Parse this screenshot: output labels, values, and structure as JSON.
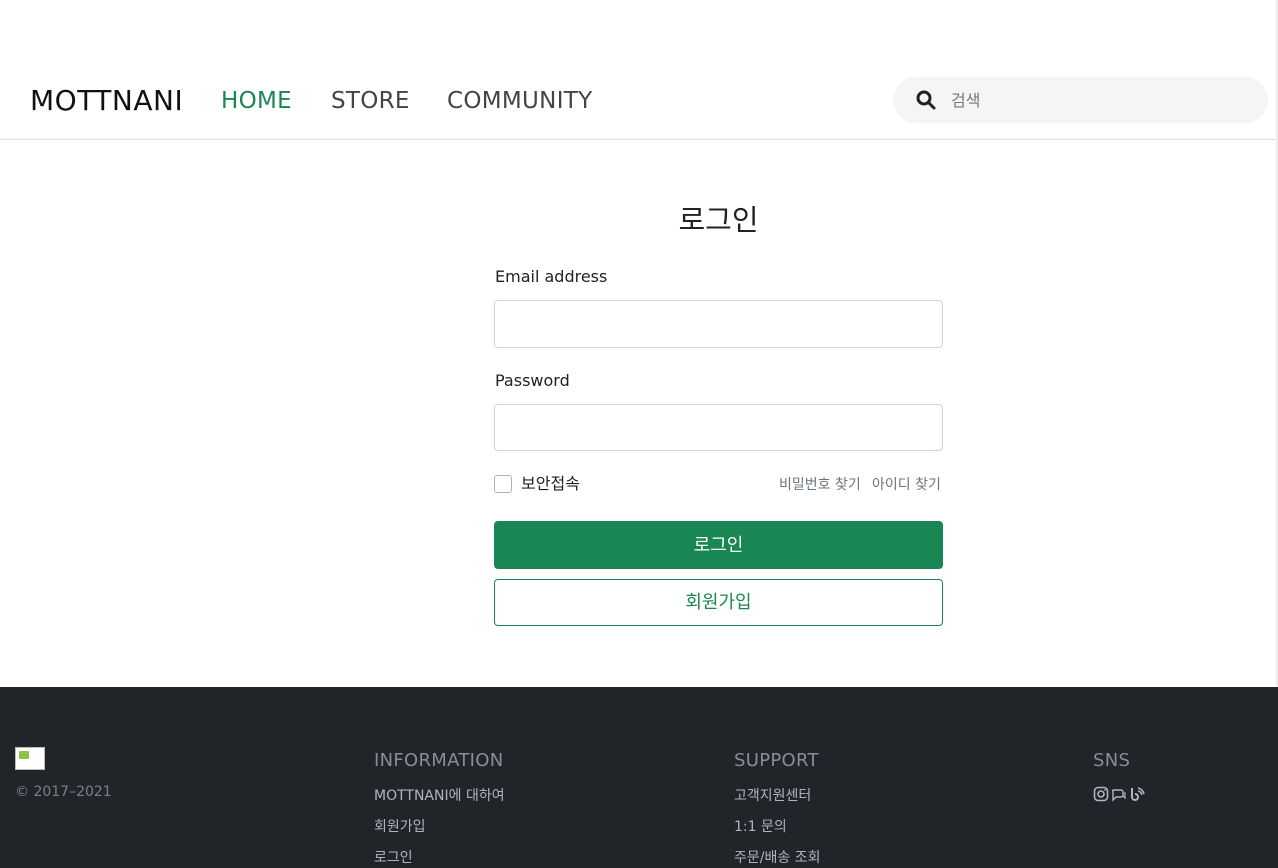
{
  "header": {
    "brand": "MOTTNANI",
    "nav": [
      {
        "label": "HOME",
        "active": true
      },
      {
        "label": "STORE",
        "active": false
      },
      {
        "label": "COMMUNITY",
        "active": false
      }
    ],
    "search": {
      "placeholder": "검색",
      "icon": "search-icon"
    }
  },
  "login": {
    "title": "로그인",
    "email_label": "Email address",
    "email_value": "",
    "password_label": "Password",
    "password_value": "",
    "secure_label": "보안접속",
    "secure_checked": false,
    "find_password": "비밀번호 찾기",
    "find_id": "아이디 찾기",
    "login_button": "로그인",
    "signup_button": "회원가입"
  },
  "footer": {
    "copyright": "© 2017–2021",
    "columns": [
      {
        "heading": "INFORMATION",
        "links": [
          "MOTTNANI에 대하여",
          "회원가입",
          "로그인"
        ]
      },
      {
        "heading": "SUPPORT",
        "links": [
          "고객지원센터",
          "1:1 문의",
          "주문/배송 조회"
        ]
      },
      {
        "heading": "SNS",
        "icons": [
          "instagram-icon",
          "chat-icon",
          "blog-icon"
        ]
      }
    ]
  },
  "colors": {
    "accent": "#198754",
    "footer_bg": "#212529",
    "search_bg": "#f5f5f5"
  }
}
